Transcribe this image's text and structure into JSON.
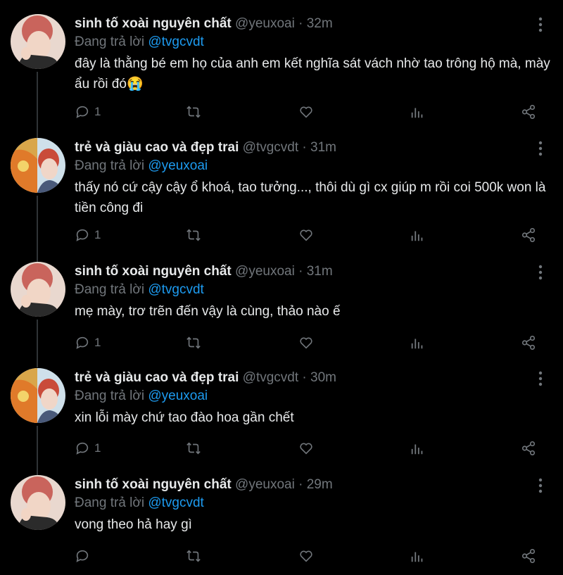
{
  "colors": {
    "background": "#000000",
    "text": "#e7e9ea",
    "muted": "#71767b",
    "link": "#1d9bf0",
    "thread_line": "#2f3336"
  },
  "tweets": [
    {
      "name": "sinh tố xoài nguyên chất",
      "handle": "@yeuxoai",
      "time": "32m",
      "reply_label": "Đang trả lời",
      "reply_to": "@tvgcvdt",
      "text": "đây là thằng bé em họ của anh em kết nghĩa sát vách nhờ tao trông hộ mà, mày ẩu rồi đó😭",
      "reply_count": "1"
    },
    {
      "name": "trẻ và giàu cao và đẹp trai",
      "handle": "@tvgcvdt",
      "time": "31m",
      "reply_label": "Đang trả lời",
      "reply_to": "@yeuxoai",
      "text": "thấy nó cứ cậy cậy ổ khoá, tao tưởng..., thôi dù gì cx giúp m rồi coi 500k won là tiền công đi",
      "reply_count": "1"
    },
    {
      "name": "sinh tố xoài nguyên chất",
      "handle": "@yeuxoai",
      "time": "31m",
      "reply_label": "Đang trả lời",
      "reply_to": "@tvgcvdt",
      "text": "mẹ mày, trơ trẽn đến vậy là cùng, thảo nào ế",
      "reply_count": "1"
    },
    {
      "name": "trẻ và giàu cao và đẹp trai",
      "handle": "@tvgcvdt",
      "time": "30m",
      "reply_label": "Đang trả lời",
      "reply_to": "@yeuxoai",
      "text": "xin lỗi mày chứ tao đào hoa gần chết",
      "reply_count": "1"
    },
    {
      "name": "sinh tố xoài nguyên chất",
      "handle": "@yeuxoai",
      "time": "29m",
      "reply_label": "Đang trả lời",
      "reply_to": "@tvgcvdt",
      "text": "vong theo hả hay gì",
      "reply_count": ""
    }
  ],
  "icons": [
    "more-icon",
    "reply-icon",
    "retweet-icon",
    "like-icon",
    "stats-icon",
    "share-icon"
  ]
}
